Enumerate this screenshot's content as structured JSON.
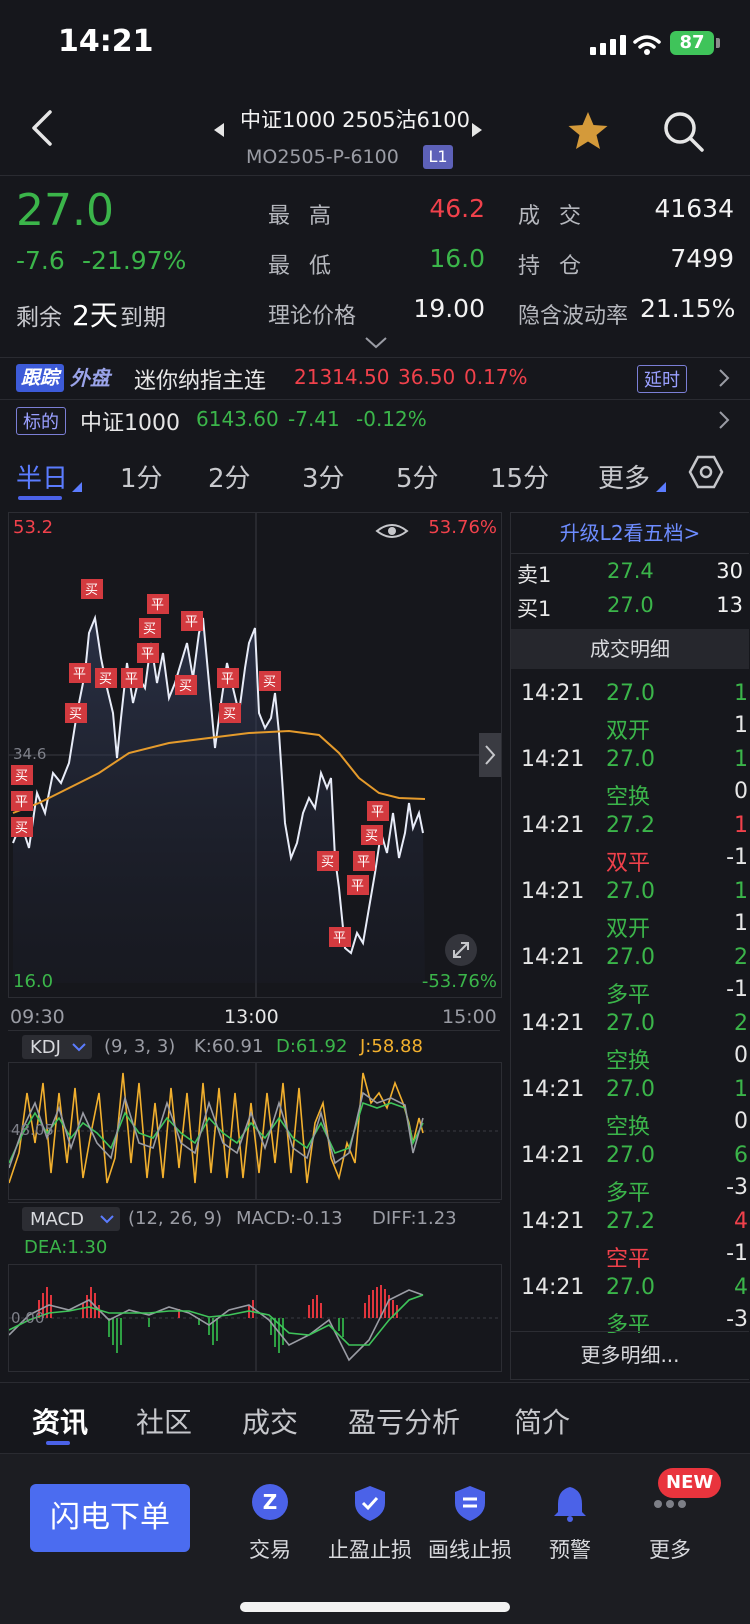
{
  "status": {
    "time": "14:21",
    "battery": "87"
  },
  "nav": {
    "title": "中证1000 2505沽6100",
    "code": "MO2505-P-6100",
    "level": "L1"
  },
  "quote": {
    "price": "27.0",
    "change": "-7.6",
    "change_pct": "-21.97%",
    "remain_label": "剩余",
    "remain_days": "2天",
    "expire_label": "到期",
    "high_label": "最 高",
    "high": "46.2",
    "low_label": "最 低",
    "low": "16.0",
    "theory_label": "理论价格",
    "theory": "19.00",
    "volume_label": "成 交",
    "volume": "41634",
    "oi_label": "持 仓",
    "oi": "7499",
    "iv_label": "隐含波动率",
    "iv": "21.15%"
  },
  "ticker1": {
    "tag1": "跟踪",
    "tag2": "外盘",
    "name": "迷你纳指主连",
    "price": "21314.50",
    "chg": "36.50",
    "pct": "0.17%",
    "delay": "延时"
  },
  "ticker2": {
    "tag": "标的",
    "name": "中证1000",
    "price": "6143.60",
    "chg": "-7.41",
    "pct": "-0.12%"
  },
  "periods": {
    "items": [
      "半日",
      "1分",
      "2分",
      "3分",
      "5分",
      "15分",
      "更多"
    ],
    "active": "半日"
  },
  "chart": {
    "max": "53.2",
    "max_pct": "53.76%",
    "min": "16.0",
    "min_pct": "-53.76%",
    "mid": "34.6",
    "t1": "09:30",
    "t2": "13:00",
    "t3": "15:00"
  },
  "kdj": {
    "name": "KDJ",
    "params": "(9, 3, 3)",
    "k": "K:60.91",
    "d": "D:61.92",
    "j": "J:58.88",
    "mid": "48.05"
  },
  "macd": {
    "name": "MACD",
    "params": "(12, 26, 9)",
    "macd": "MACD:-0.13",
    "diff": "DIFF:1.23",
    "dea": "DEA:1.30",
    "mid": "0.00"
  },
  "book": {
    "upgrade": "升级L2看五档>",
    "sell_label": "卖1",
    "sell_price": "27.4",
    "sell_vol": "30",
    "buy_label": "买1",
    "buy_price": "27.0",
    "buy_vol": "13",
    "detail_title": "成交明细",
    "more": "更多明细..."
  },
  "trades": [
    {
      "time": "14:21",
      "price": "27.0",
      "vol": "1",
      "kind": "双开",
      "chg": "1",
      "pc": "green",
      "vc": "green",
      "kc": "green"
    },
    {
      "time": "14:21",
      "price": "27.0",
      "vol": "1",
      "kind": "空换",
      "chg": "0",
      "pc": "green",
      "vc": "green",
      "kc": "green"
    },
    {
      "time": "14:21",
      "price": "27.2",
      "vol": "1",
      "kind": "双平",
      "chg": "-1",
      "pc": "green",
      "vc": "red",
      "kc": "red"
    },
    {
      "time": "14:21",
      "price": "27.0",
      "vol": "1",
      "kind": "双开",
      "chg": "1",
      "pc": "green",
      "vc": "green",
      "kc": "green"
    },
    {
      "time": "14:21",
      "price": "27.0",
      "vol": "2",
      "kind": "多平",
      "chg": "-1",
      "pc": "green",
      "vc": "green",
      "kc": "green"
    },
    {
      "time": "14:21",
      "price": "27.0",
      "vol": "2",
      "kind": "空换",
      "chg": "0",
      "pc": "green",
      "vc": "green",
      "kc": "green"
    },
    {
      "time": "14:21",
      "price": "27.0",
      "vol": "1",
      "kind": "空换",
      "chg": "0",
      "pc": "green",
      "vc": "green",
      "kc": "green"
    },
    {
      "time": "14:21",
      "price": "27.0",
      "vol": "6",
      "kind": "多平",
      "chg": "-3",
      "pc": "green",
      "vc": "green",
      "kc": "green"
    },
    {
      "time": "14:21",
      "price": "27.2",
      "vol": "4",
      "kind": "空平",
      "chg": "-1",
      "pc": "green",
      "vc": "red",
      "kc": "red"
    },
    {
      "time": "14:21",
      "price": "27.0",
      "vol": "4",
      "kind": "多平",
      "chg": "-3",
      "pc": "green",
      "vc": "green",
      "kc": "green"
    }
  ],
  "bottom_tabs": [
    "资讯",
    "社区",
    "成交",
    "盈亏分析",
    "简介"
  ],
  "actions": {
    "flash": "闪电下单",
    "items": [
      "交易",
      "止盈止损",
      "画线止损",
      "预警",
      "更多"
    ],
    "new_badge": "NEW"
  },
  "colors": {
    "red": "#f0414b",
    "green": "#3bb54a",
    "accent": "#4b62e8",
    "bg": "#16171c"
  }
}
